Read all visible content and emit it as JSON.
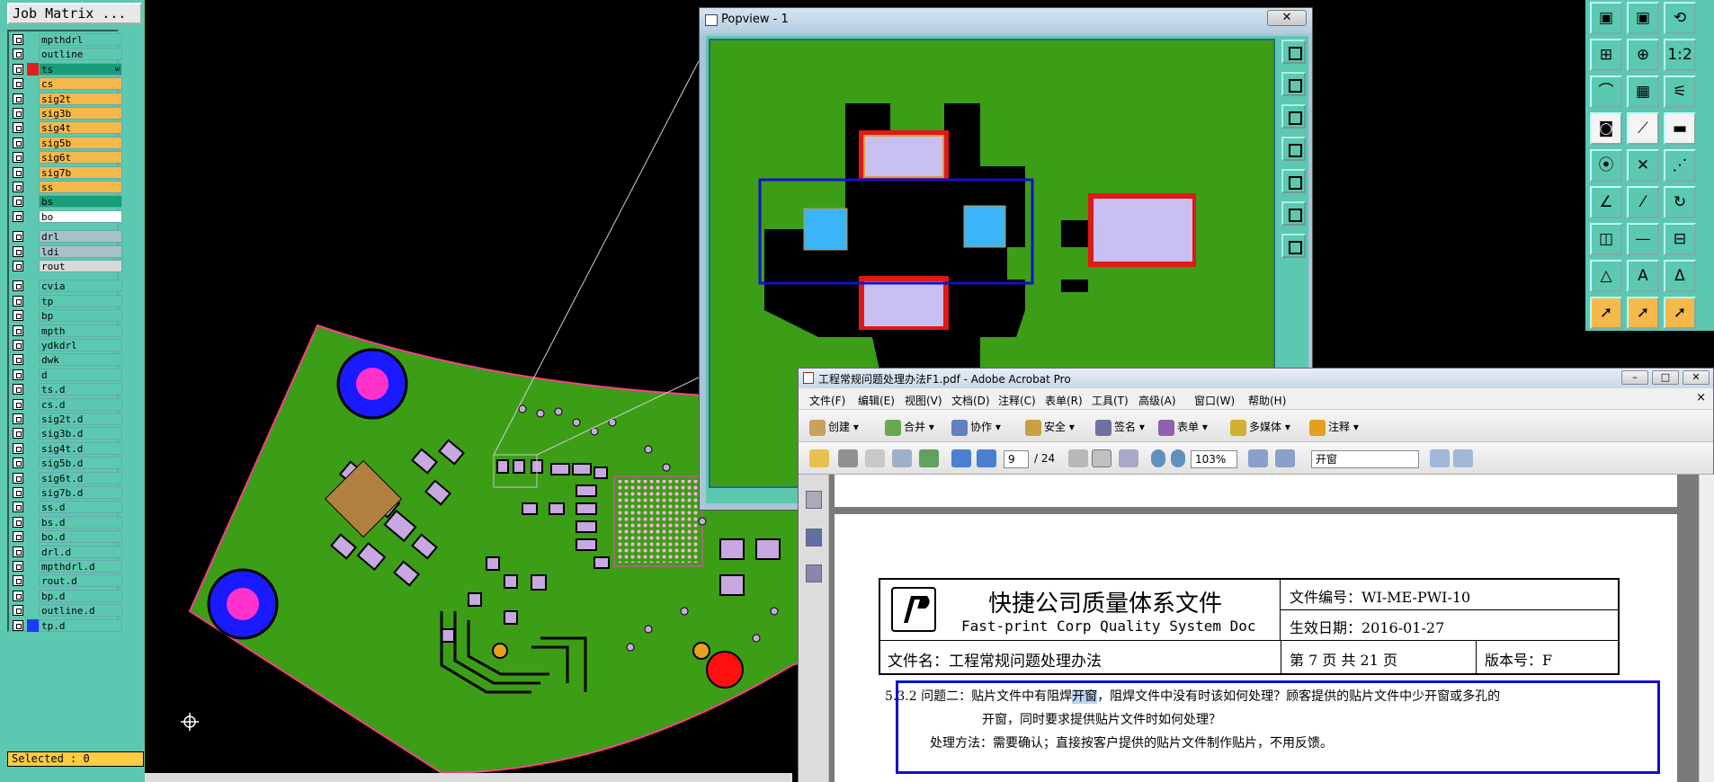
{
  "job_matrix": {
    "title": "Job Matrix ...",
    "layers": [
      {
        "name": "mpthdrl",
        "color": "#5cc8b0",
        "fill": "#5cc8b0"
      },
      {
        "name": "outline",
        "color": "#5cc8b0",
        "fill": "#5cc8b0"
      },
      {
        "name": "ts",
        "color": "#e02020",
        "fill": "#169e7a",
        "mark": "w"
      },
      {
        "name": "cs",
        "color": "#5cc8b0",
        "fill": "#f5b84a"
      },
      {
        "name": "sig2t",
        "color": "#5cc8b0",
        "fill": "#f5b84a"
      },
      {
        "name": "sig3b",
        "color": "#5cc8b0",
        "fill": "#f5b84a"
      },
      {
        "name": "sig4t",
        "color": "#5cc8b0",
        "fill": "#f5b84a"
      },
      {
        "name": "sig5b",
        "color": "#5cc8b0",
        "fill": "#f5b84a"
      },
      {
        "name": "sig6t",
        "color": "#5cc8b0",
        "fill": "#f5b84a"
      },
      {
        "name": "sig7b",
        "color": "#5cc8b0",
        "fill": "#f5b84a"
      },
      {
        "name": "ss",
        "color": "#5cc8b0",
        "fill": "#f5b84a"
      },
      {
        "name": "bs",
        "color": "#5cc8b0",
        "fill": "#169e7a"
      },
      {
        "name": "bo",
        "color": "#5cc8b0",
        "fill": "#ffffff"
      },
      {
        "name": "drl",
        "color": "#5cc8b0",
        "fill": "#a8c0c8"
      },
      {
        "name": "ldi",
        "color": "#5cc8b0",
        "fill": "#a8c0c8"
      },
      {
        "name": "rout",
        "color": "#5cc8b0",
        "fill": "#d8d8d8"
      },
      {
        "name": "cvia",
        "color": "#5cc8b0",
        "fill": "#5cc8b0"
      },
      {
        "name": "tp",
        "color": "#5cc8b0",
        "fill": "#5cc8b0"
      },
      {
        "name": "bp",
        "color": "#5cc8b0",
        "fill": "#5cc8b0"
      },
      {
        "name": "mpth",
        "color": "#5cc8b0",
        "fill": "#5cc8b0"
      },
      {
        "name": "ydkdrl",
        "color": "#5cc8b0",
        "fill": "#5cc8b0"
      },
      {
        "name": "dwk",
        "color": "#5cc8b0",
        "fill": "#5cc8b0"
      },
      {
        "name": "d",
        "color": "#5cc8b0",
        "fill": "#5cc8b0"
      },
      {
        "name": "ts.d",
        "color": "#5cc8b0",
        "fill": "#5cc8b0"
      },
      {
        "name": "cs.d",
        "color": "#5cc8b0",
        "fill": "#5cc8b0"
      },
      {
        "name": "sig2t.d",
        "color": "#5cc8b0",
        "fill": "#5cc8b0"
      },
      {
        "name": "sig3b.d",
        "color": "#5cc8b0",
        "fill": "#5cc8b0"
      },
      {
        "name": "sig4t.d",
        "color": "#5cc8b0",
        "fill": "#5cc8b0"
      },
      {
        "name": "sig5b.d",
        "color": "#5cc8b0",
        "fill": "#5cc8b0"
      },
      {
        "name": "sig6t.d",
        "color": "#5cc8b0",
        "fill": "#5cc8b0"
      },
      {
        "name": "sig7b.d",
        "color": "#5cc8b0",
        "fill": "#5cc8b0"
      },
      {
        "name": "ss.d",
        "color": "#5cc8b0",
        "fill": "#5cc8b0"
      },
      {
        "name": "bs.d",
        "color": "#5cc8b0",
        "fill": "#5cc8b0"
      },
      {
        "name": "bo.d",
        "color": "#5cc8b0",
        "fill": "#5cc8b0"
      },
      {
        "name": "drl.d",
        "color": "#5cc8b0",
        "fill": "#5cc8b0"
      },
      {
        "name": "mpthdrl.d",
        "color": "#5cc8b0",
        "fill": "#5cc8b0"
      },
      {
        "name": "rout.d",
        "color": "#5cc8b0",
        "fill": "#5cc8b0"
      },
      {
        "name": "bp.d",
        "color": "#5cc8b0",
        "fill": "#5cc8b0"
      },
      {
        "name": "outline.d",
        "color": "#5cc8b0",
        "fill": "#5cc8b0"
      },
      {
        "name": "tp.d",
        "color": "#1a3cff",
        "fill": "#5cc8b0"
      }
    ],
    "selected_label": "Selected : 0"
  },
  "popview": {
    "title": "Popview - 1",
    "close_glyph": "✕",
    "tools": [
      "zoom-fit-icon",
      "zoom-in-icon",
      "zoom-out-icon",
      "pan-left-icon",
      "pan-right-icon",
      "zoom-area-icon",
      "center-icon"
    ]
  },
  "toolbox": {
    "buttons": [
      {
        "icon": "move-left-icon",
        "glyph": "▣",
        "style": "normal"
      },
      {
        "icon": "move-right-icon",
        "glyph": "▣",
        "style": "normal"
      },
      {
        "icon": "redraw-icon",
        "glyph": "⟲",
        "style": "normal"
      },
      {
        "icon": "zoom-fit-icon",
        "glyph": "⊞",
        "style": "normal"
      },
      {
        "icon": "zoom-in-icon",
        "glyph": "⊕",
        "style": "normal"
      },
      {
        "icon": "scale-icon",
        "glyph": "1:2",
        "style": "normal"
      },
      {
        "icon": "measure-icon",
        "glyph": "⌒",
        "style": "normal"
      },
      {
        "icon": "grid-icon",
        "glyph": "▦",
        "style": "normal"
      },
      {
        "icon": "net-icon",
        "glyph": "⚟",
        "style": "normal"
      },
      {
        "icon": "pad-icon",
        "glyph": "◙",
        "style": "white"
      },
      {
        "icon": "line-icon",
        "glyph": "⟋",
        "style": "white"
      },
      {
        "icon": "dash-icon",
        "glyph": "▬",
        "style": "white"
      },
      {
        "icon": "node-icon",
        "glyph": "⦿",
        "style": "normal"
      },
      {
        "icon": "cross-icon",
        "glyph": "✕",
        "style": "normal"
      },
      {
        "icon": "connect-icon",
        "glyph": "⋰",
        "style": "normal"
      },
      {
        "icon": "angle-icon",
        "glyph": "∠",
        "style": "normal"
      },
      {
        "icon": "slash-icon",
        "glyph": "⁄",
        "style": "normal"
      },
      {
        "icon": "arc-icon",
        "glyph": "↻",
        "style": "normal"
      },
      {
        "icon": "feature-icon",
        "glyph": "◫",
        "style": "normal"
      },
      {
        "icon": "minus-icon",
        "glyph": "—",
        "style": "normal"
      },
      {
        "icon": "split-icon",
        "glyph": "⊟",
        "style": "normal"
      },
      {
        "icon": "triangle-icon",
        "glyph": "△",
        "style": "normal"
      },
      {
        "icon": "triangle-a-icon",
        "glyph": "A",
        "style": "normal"
      },
      {
        "icon": "triangle-b-icon",
        "glyph": "Δ",
        "style": "normal"
      },
      {
        "icon": "select-icon",
        "glyph": "➚",
        "style": "orange"
      },
      {
        "icon": "select-add-icon",
        "glyph": "➚",
        "style": "orange"
      },
      {
        "icon": "select-net-icon",
        "glyph": "➚",
        "style": "orange"
      }
    ]
  },
  "acrobat": {
    "title": "工程常规问题处理办法F1.pdf - Adobe Acrobat Pro",
    "window_buttons": [
      "–",
      "□",
      "✕"
    ],
    "menu": [
      "文件(F)",
      "编辑(E)",
      "视图(V)",
      "文档(D)",
      "注释(C)",
      "表单(R)",
      "工具(T)",
      "高级(A)",
      "窗口(W)",
      "帮助(H)"
    ],
    "menu_close": "×",
    "toolbar1": [
      {
        "label": "创建 ▾",
        "icon": "create-icon",
        "color": "#c8a060"
      },
      {
        "label": "合并 ▾",
        "icon": "combine-icon",
        "color": "#6aa84f"
      },
      {
        "label": "协作 ▾",
        "icon": "collaborate-icon",
        "color": "#6080c0"
      },
      {
        "label": "安全 ▾",
        "icon": "lock-icon",
        "color": "#c8a040"
      },
      {
        "label": "签名 ▾",
        "icon": "sign-icon",
        "color": "#7070a0"
      },
      {
        "label": "表单 ▾",
        "icon": "form-icon",
        "color": "#9060b0"
      },
      {
        "label": "多媒体 ▾",
        "icon": "multimedia-icon",
        "color": "#d0b030"
      },
      {
        "label": "注释 ▾",
        "icon": "comment-icon",
        "color": "#e0a020"
      }
    ],
    "page_current": "9",
    "page_total": "/ 24",
    "zoom": "103%",
    "search_value": "开窗",
    "doc": {
      "company_title": "快捷公司质量体系文件",
      "company_subtitle": "Fast-print Corp Quality System Doc",
      "doc_no": "文件编号：WI-ME-PWI-10",
      "effective_date": "生效日期：2016-01-27",
      "file_name": "文件名：工程常规问题处理办法",
      "page_info": "第 7 页 共 21 页",
      "version": "版本号：F",
      "q_prefix": "5.3.2 问题二：贴片文件中有阻焊",
      "q_highlight": "开窗",
      "q_rest": "，阻焊文件中没有时该如何处理？顾客提供的贴片文件中少开窗或多孔的",
      "q_line2": "开窗，同时要求提供贴片文件时如何处理？",
      "method": "处理方法：需要确认；直接按客户提供的贴片文件制作贴片，不用反馈。"
    }
  }
}
